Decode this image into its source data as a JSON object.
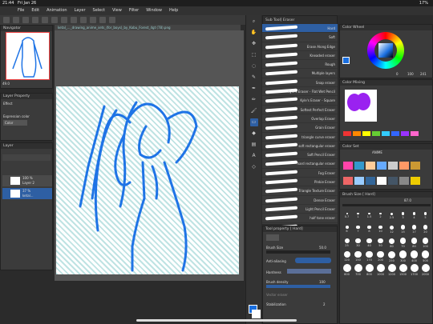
{
  "status": {
    "time": "21:44",
    "date": "Fri Jan 26",
    "battery": "17%"
  },
  "menu": [
    "File",
    "Edit",
    "Animation",
    "Layer",
    "Select",
    "View",
    "Filter",
    "Window",
    "Help"
  ],
  "canvas_tab": "ketal_..._drawing_anime_sets_(for_boys)_by_Kobu_Forest_4gt (78).png",
  "navigator": {
    "title": "Navigator",
    "zoom": "49.0"
  },
  "layer_property": {
    "title": "Layer Property",
    "effect": "Effect",
    "expression_label": "Expression color",
    "expression_value": "Color"
  },
  "layers": {
    "title": "Layer",
    "items": [
      {
        "opacity": "100 %",
        "name": "Layer 2"
      },
      {
        "opacity": "37 %",
        "name": "ketal..."
      }
    ]
  },
  "subtool": {
    "title": "Sub Tool[ Eraser",
    "tabs": [
      "Eraser",
      "Kyle's"
    ]
  },
  "brushes": [
    "Hard",
    "Soft",
    "Erase Along Edge",
    "Kneaded eraser",
    "Rough",
    "Multiple layers",
    "Snap eraser",
    "Kyle's Eraser - Flat Wet Pencil",
    "Kyle's Eraser - Square",
    "Softest Perfect Eraser",
    "Overlap Eraser",
    "Grain Eraser",
    "triangle curve eraser",
    "soft rectangular eraser",
    "Soft Pencil Eraser",
    "hard rectangular eraser",
    "Fog Eraser",
    "Pinkie Eraser",
    "Triangle Texture Eraser",
    "Dense Eraser",
    "Light Pencil Eraser",
    "half tone eraser",
    "Altered Eraser"
  ],
  "tool_property": {
    "title": "Tool property [ Hard]",
    "brush_size": "Brush Size",
    "brush_size_val": "50.0",
    "anti_aliasing": "Anti-aliasing",
    "hardness": "Hardness",
    "brush_density": "Brush density",
    "density_val": "100",
    "vector_eraser": "Vector eraser",
    "stabilization": "Stabilization",
    "stab_val": "2"
  },
  "color_wheel": {
    "title": "Color Wheel",
    "values": [
      "0",
      "100",
      "241"
    ]
  },
  "color_mixing": {
    "title": "Color Mixing"
  },
  "color_set": {
    "title": "Color Set",
    "name": "ANIME"
  },
  "brush_size_panel": {
    "title": "Brush Size [ Hard]",
    "value": "87.0",
    "sizes": [
      "0.7",
      "1",
      "1.5",
      "2",
      "2.5",
      "3",
      "4",
      "5",
      "6",
      "7",
      "8",
      "10",
      "12",
      "15",
      "17",
      "20",
      "25",
      "30",
      "40",
      "50",
      "60",
      "70",
      "80",
      "100",
      "120",
      "150",
      "170",
      "200",
      "250",
      "300",
      "400",
      "500",
      "600",
      "700",
      "800",
      "1000",
      "1200",
      "1500",
      "1700",
      "2000"
    ]
  },
  "colors": {
    "main": "#1a6fe0",
    "line": "#1f74e6",
    "purple": "#9a22f0"
  }
}
